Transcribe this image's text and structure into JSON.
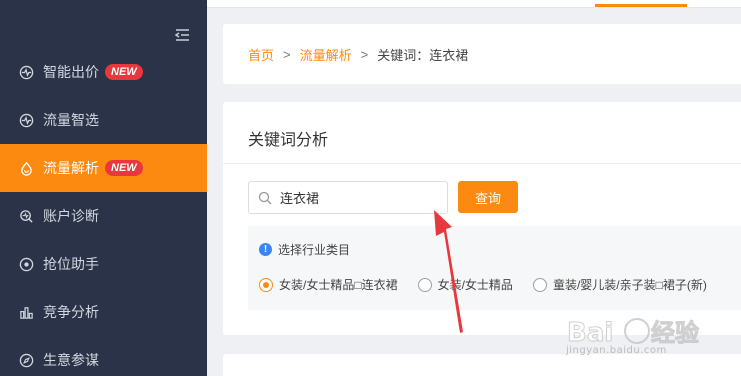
{
  "sidebar": {
    "items": [
      {
        "label": "智能出价",
        "badge": "NEW",
        "icon": "bid-icon"
      },
      {
        "label": "流量智选",
        "badge": "",
        "icon": "pulse-icon"
      },
      {
        "label": "流量解析",
        "badge": "NEW",
        "icon": "drop-icon",
        "active": true
      },
      {
        "label": "账户诊断",
        "badge": "",
        "icon": "diagnose-icon"
      },
      {
        "label": "抢位助手",
        "badge": "",
        "icon": "target-icon"
      },
      {
        "label": "竞争分析",
        "badge": "",
        "icon": "bar-chart-icon"
      },
      {
        "label": "生意参谋",
        "badge": "",
        "icon": "compass-icon"
      }
    ]
  },
  "breadcrumb": {
    "home": "首页",
    "sep": ">",
    "section": "流量解析",
    "current": "关键词：连衣裙"
  },
  "analysis": {
    "title": "关键词分析",
    "search_value": "连衣裙",
    "query_label": "查询",
    "category_hint": "选择行业类目",
    "options": [
      {
        "label": "女装/女士精品□连衣裙",
        "checked": true
      },
      {
        "label": "女装/女士精品",
        "checked": false
      },
      {
        "label": "童装/婴儿装/亲子装□裙子(新)",
        "checked": false
      }
    ]
  },
  "colors": {
    "accent": "#fd8a10",
    "sidebar_bg": "#2b3348",
    "badge": "#e8383d",
    "info": "#3b84f4",
    "annotation_arrow": "#e8383d"
  },
  "watermark": {
    "logo": "Baidu经验",
    "url": "jingyan.baidu.com"
  }
}
